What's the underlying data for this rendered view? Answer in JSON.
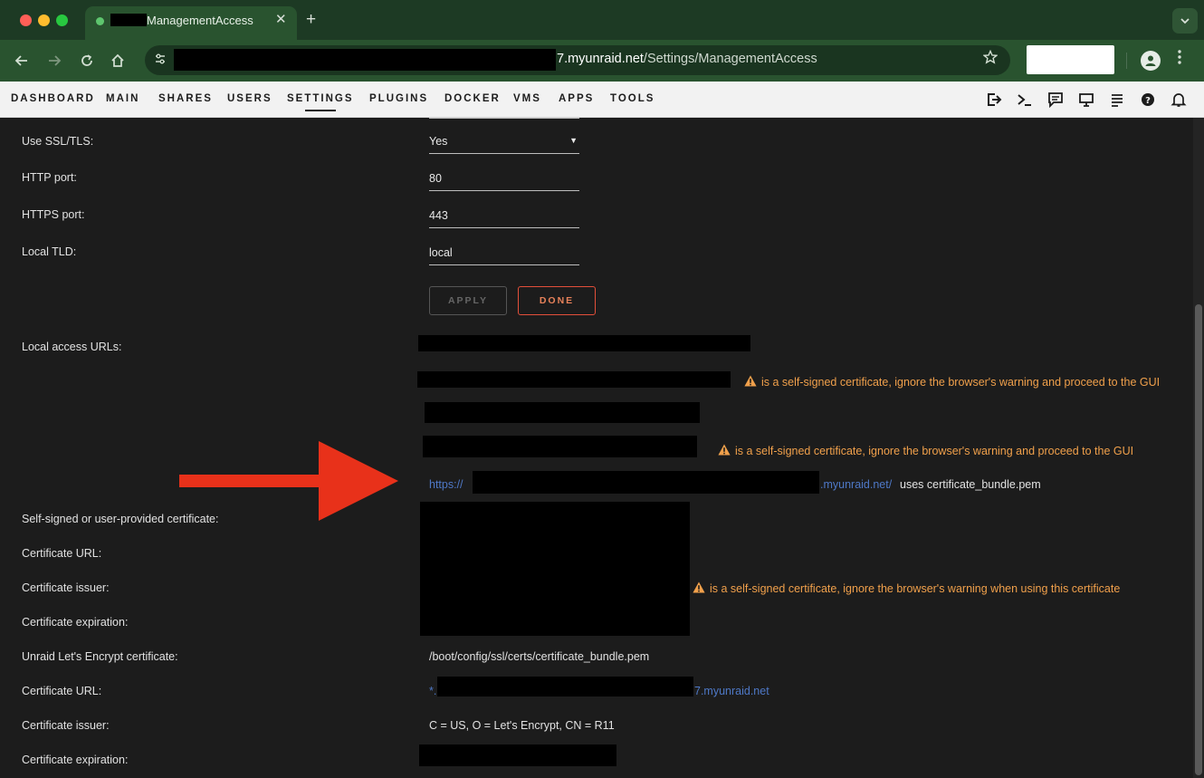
{
  "browser": {
    "tab_title": "ManagementAccess",
    "new_tab_glyph": "+",
    "close_glyph": "✕",
    "url_domain": "7.myunraid.net",
    "url_path": "/Settings/ManagementAccess"
  },
  "nav": {
    "items": [
      "DASHBOARD",
      "MAIN",
      "SHARES",
      "USERS",
      "SETTINGS",
      "PLUGINS",
      "DOCKER",
      "VMS",
      "APPS",
      "TOOLS"
    ],
    "active": "SETTINGS",
    "icons": [
      "logout-icon",
      "terminal-icon",
      "feedback-icon",
      "monitor-icon",
      "log-icon",
      "help-icon",
      "bell-icon"
    ]
  },
  "form": {
    "ssl_label": "Use SSL/TLS:",
    "ssl_value": "Yes",
    "http_label": "HTTP port:",
    "http_value": "80",
    "https_label": "HTTPS port:",
    "https_value": "443",
    "tld_label": "Local TLD:",
    "tld_value": "local",
    "apply_label": "APPLY",
    "done_label": "DONE"
  },
  "access": {
    "local_urls_label": "Local access URLs:",
    "warn_gui": "is a self-signed certificate, ignore the browser's warning and proceed to the GUI",
    "https_prefix": "https://",
    "https_suffix": ".myunraid.net/",
    "uses_text": "uses certificate_bundle.pem"
  },
  "self_signed": {
    "label": "Self-signed or user-provided certificate:",
    "url_label": "Certificate URL:",
    "issuer_label": "Certificate issuer:",
    "expiration_label": "Certificate expiration:",
    "warn": "is a self-signed certificate, ignore the browser's warning when using this certificate"
  },
  "letsencrypt": {
    "label": "Unraid Let's Encrypt certificate:",
    "path": "/boot/config/ssl/certs/certificate_bundle.pem",
    "url_label": "Certificate URL:",
    "url_prefix": "*.",
    "url_suffix": "7.myunraid.net",
    "issuer_label": "Certificate issuer:",
    "issuer_value": "C = US, O = Let's Encrypt, CN = R11",
    "expiration_label": "Certificate expiration:"
  },
  "colors": {
    "warning": "#f0a04b",
    "link": "#4e78c6",
    "done_border": "#e34f3a",
    "arrow": "#e8311a"
  }
}
